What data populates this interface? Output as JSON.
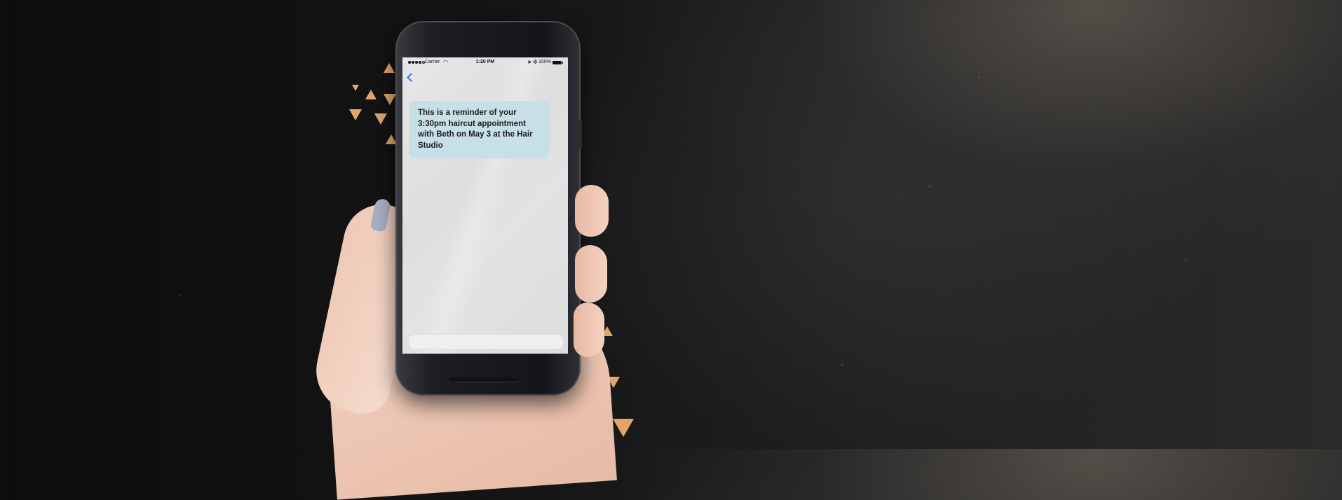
{
  "colors": {
    "accent_triangles": "#e3a56a",
    "message_bubble": "#c7dfe6",
    "ios_blue": "#1a7cf5"
  },
  "statusbar": {
    "carrier": "Carrier",
    "time": "1:20 PM",
    "battery": "100%",
    "wifi_icon": "wifi-icon",
    "location_icon": "location-icon",
    "bluetooth_icon": "bluetooth-icon"
  },
  "nav": {
    "back_icon": "chevron-left-icon"
  },
  "message": {
    "text": "This is a reminder of your 3:30pm haircut appointment with Beth on May 3 at the Hair Studio"
  },
  "compose": {
    "placeholder": ""
  }
}
